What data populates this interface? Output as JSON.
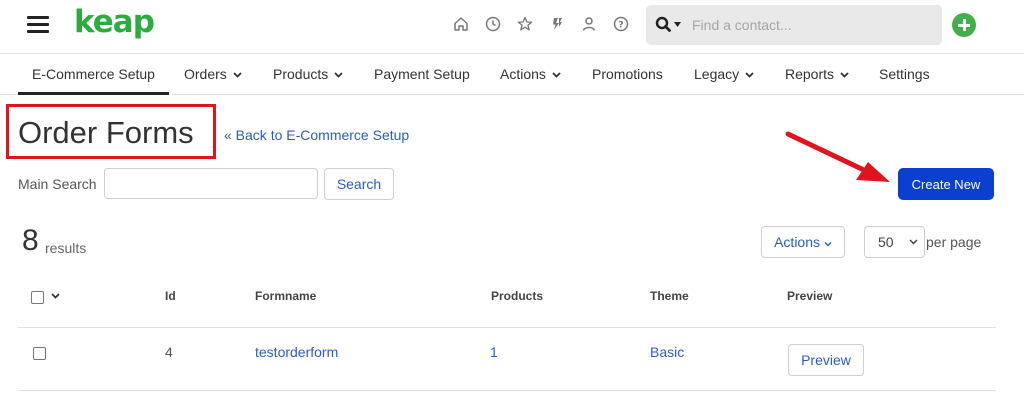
{
  "brand": {
    "logo_text": "keap",
    "logo_color": "#2dac3e",
    "accent_blue": "#0a3fcf",
    "link_color": "#2a5dc4",
    "highlight_red": "#e0141c"
  },
  "header": {
    "icons": [
      "home-icon",
      "clock-icon",
      "star-icon",
      "lightning-icon",
      "person-icon",
      "help-icon"
    ],
    "search_placeholder": "Find a contact...",
    "add_icon": "plus-circle-icon"
  },
  "nav": {
    "items": [
      {
        "label": "E-Commerce Setup",
        "has_dropdown": false,
        "active": true
      },
      {
        "label": "Orders",
        "has_dropdown": true
      },
      {
        "label": "Products",
        "has_dropdown": true
      },
      {
        "label": "Payment Setup",
        "has_dropdown": false
      },
      {
        "label": "Actions",
        "has_dropdown": true
      },
      {
        "label": "Promotions",
        "has_dropdown": false
      },
      {
        "label": "Legacy",
        "has_dropdown": true
      },
      {
        "label": "Reports",
        "has_dropdown": true
      },
      {
        "label": "Settings",
        "has_dropdown": false
      }
    ]
  },
  "page": {
    "title": "Order Forms",
    "back_link": "« Back to E-Commerce Setup",
    "search_label": "Main Search",
    "search_value": "",
    "search_button": "Search",
    "create_button": "Create New",
    "result_count": "8",
    "results_label": "results",
    "actions_button": "Actions",
    "per_page_value": "50",
    "per_page_label": "per page"
  },
  "table": {
    "columns": [
      "Id",
      "Formname",
      "Products",
      "Theme",
      "Preview"
    ],
    "rows": [
      {
        "id": "4",
        "formname": "testorderform",
        "products": "1",
        "theme": "Basic",
        "preview": "Preview",
        "checked": false
      }
    ]
  }
}
